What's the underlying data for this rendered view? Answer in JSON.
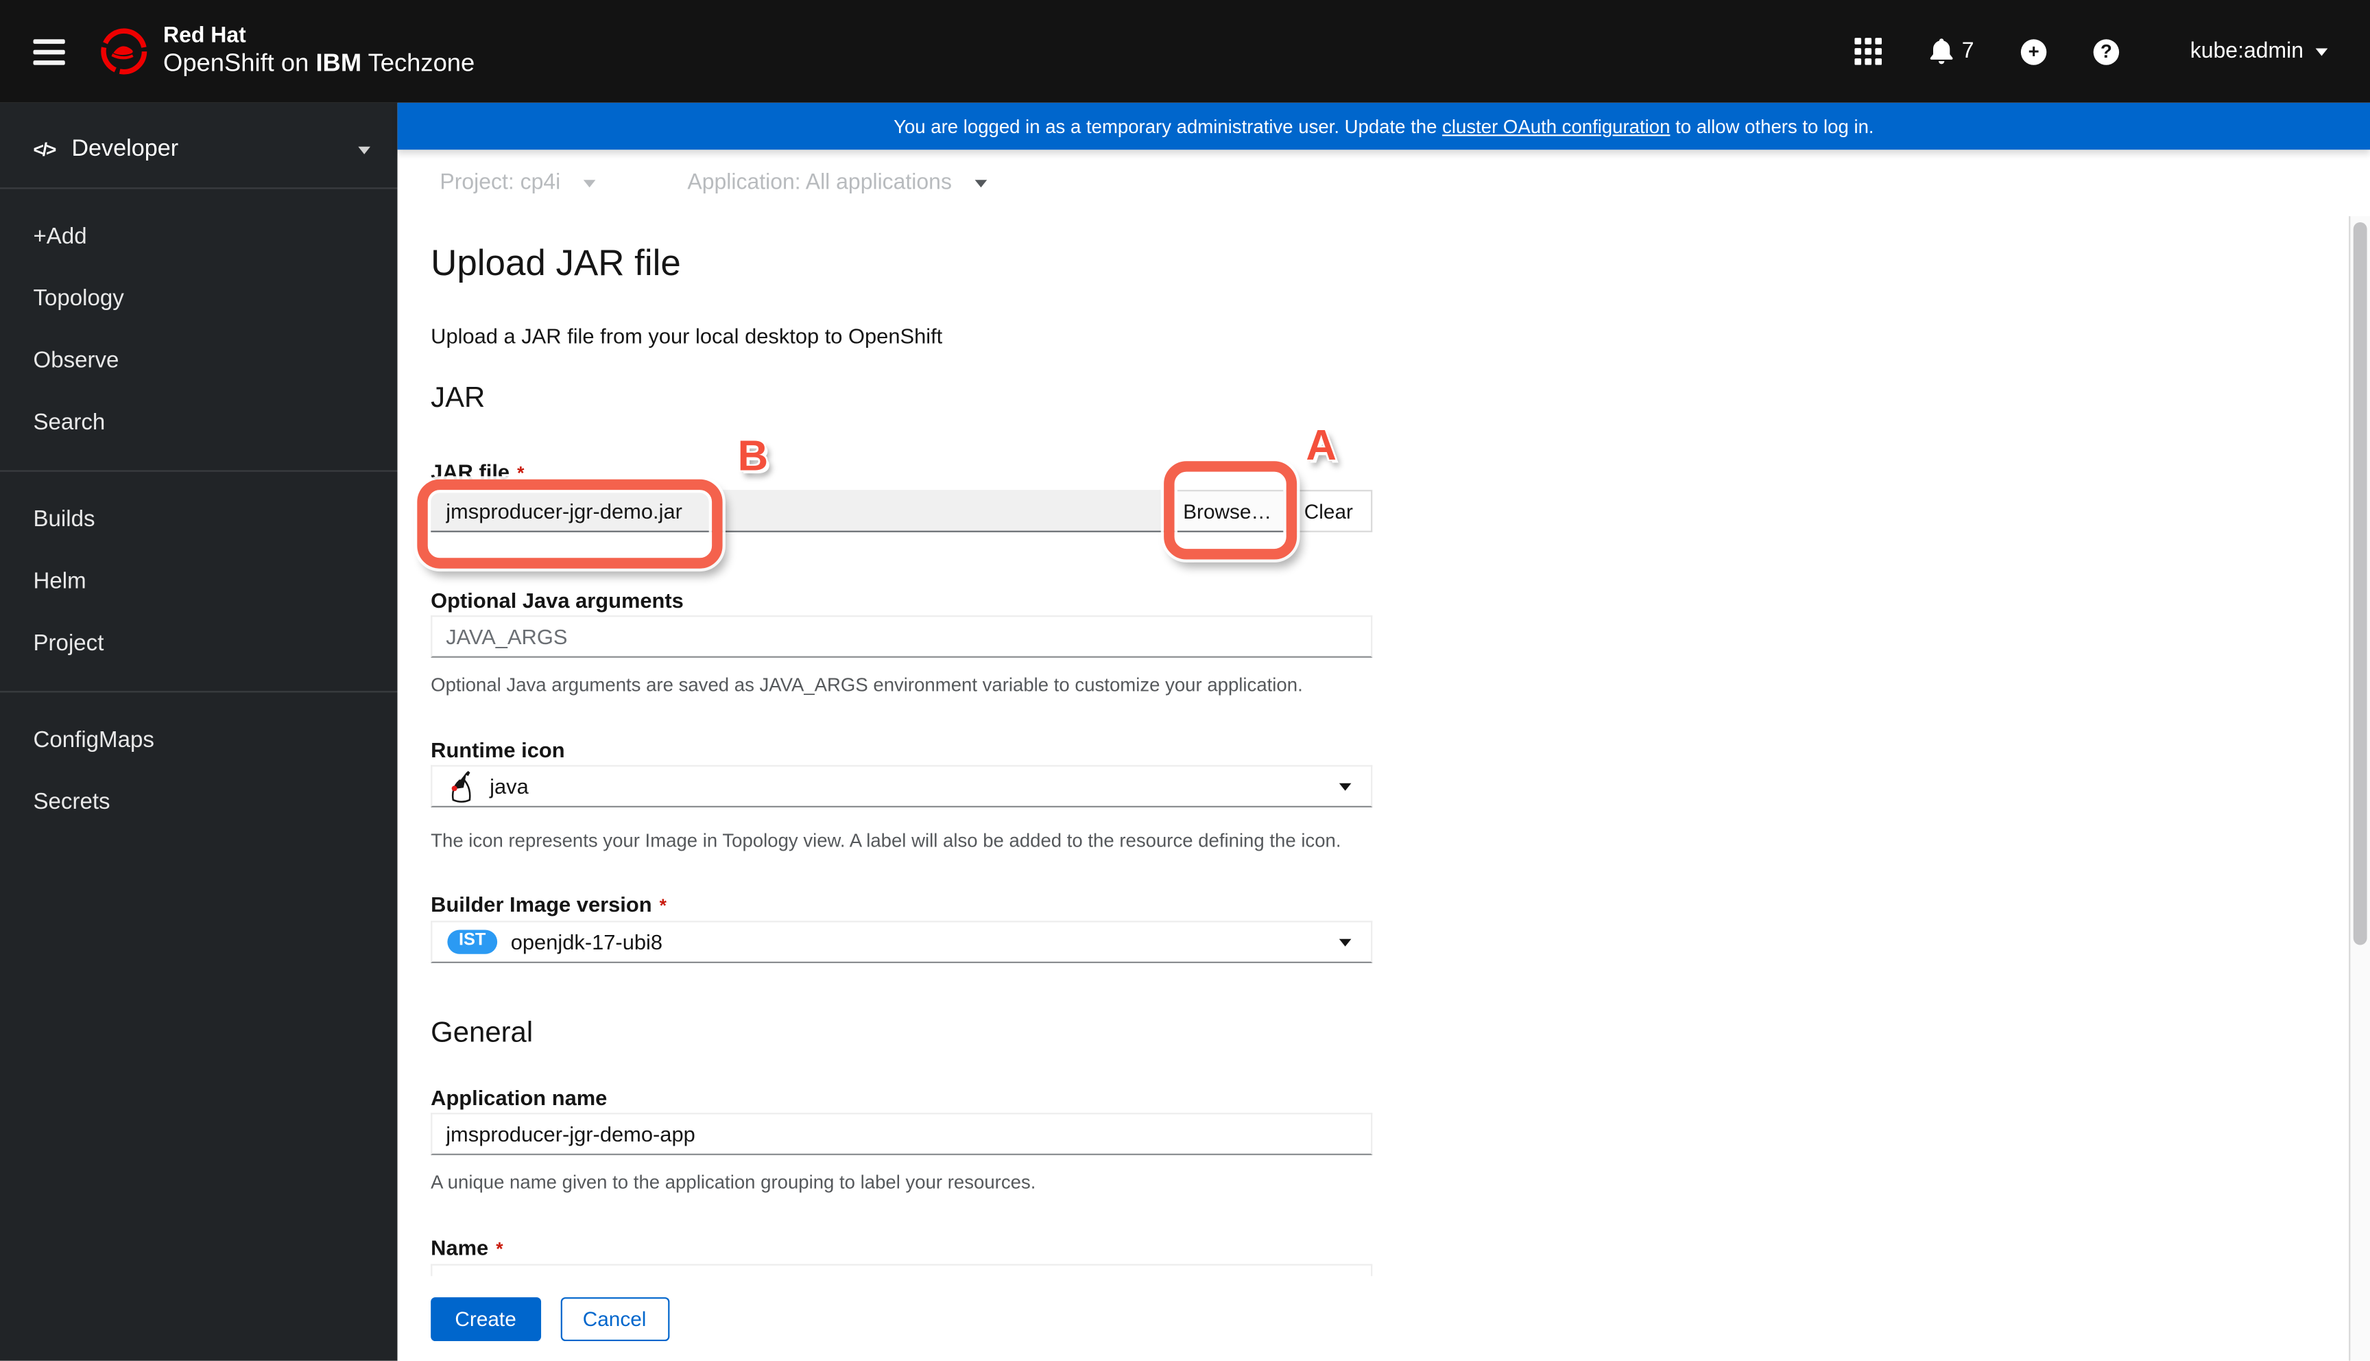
{
  "masthead": {
    "brand_line1": "Red Hat",
    "brand_line2_prefix": "OpenShift on ",
    "brand_line2_bold": "IBM",
    "brand_line2_suffix": " Techzone",
    "notification_count": "7",
    "user": "kube:admin"
  },
  "icons": {
    "developer": "</>",
    "plus": "+",
    "question": "?"
  },
  "banner": {
    "text_before": "You are logged in as a temporary administrative user. Update the ",
    "link": "cluster OAuth configuration",
    "text_after": " to allow others to log in."
  },
  "sidebar": {
    "perspective": "Developer",
    "groups": [
      {
        "items": [
          "+Add",
          "Topology",
          "Observe",
          "Search"
        ]
      },
      {
        "items": [
          "Builds",
          "Helm",
          "Project"
        ]
      },
      {
        "items": [
          "ConfigMaps",
          "Secrets"
        ]
      }
    ]
  },
  "toolbar": {
    "project": "Project: cp4i",
    "application": "Application: All applications"
  },
  "page": {
    "title": "Upload JAR file",
    "description": "Upload a JAR file from your local desktop to OpenShift",
    "required_indicator": "*",
    "jar": {
      "heading": "JAR",
      "file": {
        "label": "JAR file",
        "value": "jmsproducer-jgr-demo.jar",
        "browse": "Browse…",
        "clear": "Clear"
      },
      "java_args": {
        "label": "Optional Java arguments",
        "placeholder": "JAVA_ARGS",
        "help": "Optional Java arguments are saved as JAVA_ARGS environment variable to customize your application."
      },
      "runtime_icon": {
        "label": "Runtime icon",
        "value": "java",
        "help": "The icon represents your Image in Topology view. A label will also be added to the resource defining the icon."
      },
      "builder_image": {
        "label": "Builder Image version",
        "badge": "IST",
        "value": "openjdk-17-ubi8"
      }
    },
    "general": {
      "heading": "General",
      "application_name": {
        "label": "Application name",
        "value": "jmsproducer-jgr-demo-app",
        "help": "A unique name given to the application grouping to label your resources."
      },
      "name": {
        "label": "Name"
      }
    },
    "actions": {
      "create": "Create",
      "cancel": "Cancel"
    },
    "annotations": {
      "a": "A",
      "b": "B"
    }
  },
  "colors": {
    "accent": "#0066cc",
    "masthead_bg": "#131313",
    "sidebar_bg": "#212427",
    "annotation_red": "#f4624d",
    "required_red": "#c9190b",
    "badge_blue": "#2b9af3"
  }
}
